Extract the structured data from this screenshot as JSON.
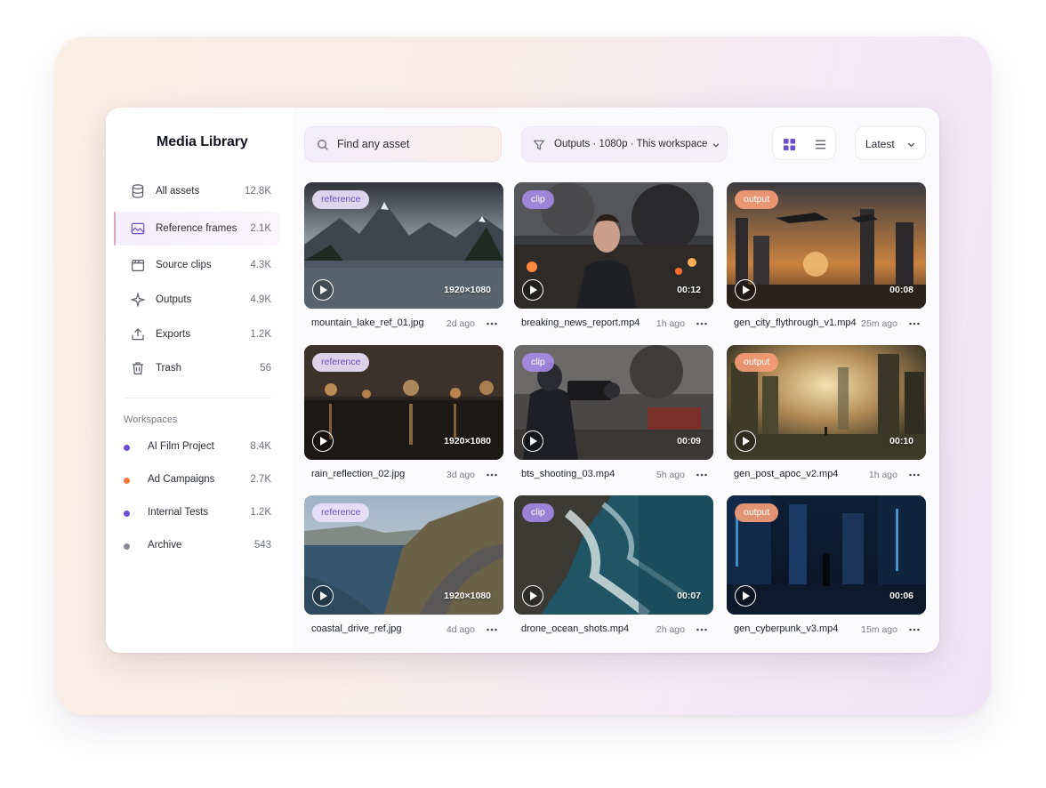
{
  "app": {
    "title": "Media Library"
  },
  "nav": [
    {
      "label": "All assets",
      "count": "12.8K",
      "icon": "database-icon"
    },
    {
      "label": "Reference frames",
      "count": "2.1K",
      "icon": "image-icon",
      "active": true
    },
    {
      "label": "Source clips",
      "count": "4.3K",
      "icon": "clapperboard-icon"
    },
    {
      "label": "Outputs",
      "count": "4.9K",
      "icon": "sparkle-icon"
    },
    {
      "label": "Exports",
      "count": "1.2K",
      "icon": "upload-icon"
    },
    {
      "label": "Trash",
      "count": "56",
      "icon": "trash-icon"
    }
  ],
  "workspaces": {
    "heading": "Workspaces",
    "items": [
      {
        "label": "AI Film Project",
        "count": "8.4K",
        "color": "#6a4fd6"
      },
      {
        "label": "Ad Campaigns",
        "count": "2.7K",
        "color": "#f07a3e"
      },
      {
        "label": "Internal Tests",
        "count": "1.2K",
        "color": "#6a4fd6"
      },
      {
        "label": "Archive",
        "count": "543",
        "color": "#8a8a94"
      }
    ]
  },
  "toolbar": {
    "search_placeholder": "Find any asset",
    "filter_label": "Outputs · 1080p · This workspace",
    "sort_label": "Latest"
  },
  "colors": {
    "accent": "#6c4fd1",
    "reference_tag": "#6b4fc2",
    "clip_tag": "#a88ceb",
    "output_tag": "#f49c76"
  },
  "assets": [
    {
      "tag": "reference",
      "badge": "1920×1080",
      "name": "mountain_lake_ref_01.jpg",
      "time": "2d ago",
      "scene": "mountain-lake"
    },
    {
      "tag": "clip",
      "badge": "00:12",
      "name": "breaking_news_report.mp4",
      "time": "1h ago",
      "scene": "news-report"
    },
    {
      "tag": "output",
      "badge": "00:08",
      "name": "gen_city_flythrough_v1.mp4",
      "time": "25m ago",
      "scene": "city-flythrough"
    },
    {
      "tag": "reference",
      "badge": "1920×1080",
      "name": "rain_reflection_02.jpg",
      "time": "3d ago",
      "scene": "rain-reflection"
    },
    {
      "tag": "clip",
      "badge": "00:09",
      "name": "bts_shooting_03.mp4",
      "time": "5h ago",
      "scene": "bts-shooting"
    },
    {
      "tag": "output",
      "badge": "00:10",
      "name": "gen_post_apoc_v2.mp4",
      "time": "1h ago",
      "scene": "post-apoc"
    },
    {
      "tag": "reference",
      "badge": "1920×1080",
      "name": "coastal_drive_ref.jpg",
      "time": "4d ago",
      "scene": "coastal-drive"
    },
    {
      "tag": "clip",
      "badge": "00:07",
      "name": "drone_ocean_shots.mp4",
      "time": "2h ago",
      "scene": "drone-ocean"
    },
    {
      "tag": "output",
      "badge": "00:06",
      "name": "gen_cyberpunk_v3.mp4",
      "time": "15m ago",
      "scene": "cyberpunk"
    }
  ]
}
